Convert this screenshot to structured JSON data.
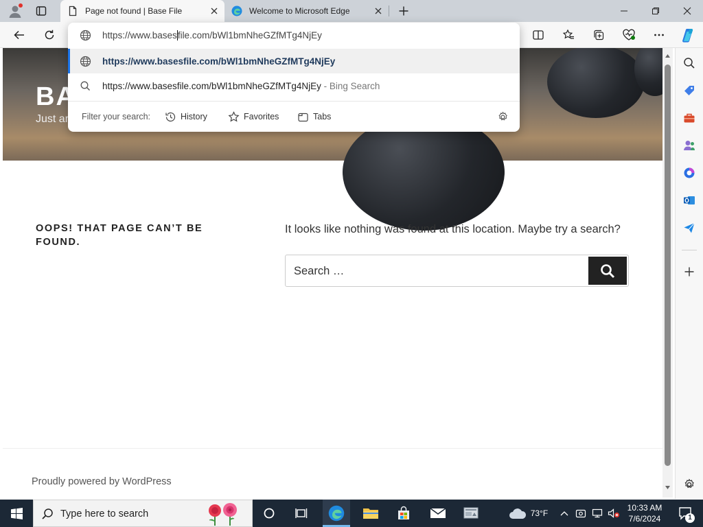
{
  "browser": {
    "tabs": [
      {
        "title": "Page not found | Base File",
        "active": true
      },
      {
        "title": "Welcome to Microsoft Edge",
        "active": false
      }
    ],
    "address": {
      "typed_url": "https://www.basesfile.com/bWl1bmNheGZfMTg4NjEy",
      "typed_prefix": "https://www.bases",
      "typed_suffix": "file.com/bWl1bmNheGZfMTg4NjEy"
    },
    "suggestions": [
      {
        "text": "https://www.basesfile.com/bWl1bmNheGZfMTg4NjEy",
        "type": "url",
        "selected": true
      },
      {
        "text": "https://www.basesfile.com/bWl1bmNheGZfMTg4NjEy",
        "suffix": "- Bing Search",
        "type": "search",
        "selected": false
      }
    ],
    "filter": {
      "label": "Filter your search:",
      "chips": [
        "History",
        "Favorites",
        "Tabs"
      ]
    }
  },
  "page": {
    "hero_title": "BA",
    "hero_subtitle": "Just ar",
    "error_title": "OOPS! THAT PAGE CAN’T BE FOUND.",
    "error_message": "It looks like nothing was found at this location. Maybe try a search?",
    "search_placeholder": "Search …",
    "footer": "Proudly powered by WordPress"
  },
  "taskbar": {
    "search_placeholder": "Type here to search",
    "weather": "73°F",
    "time": "10:33 AM",
    "date": "7/6/2024",
    "notification_count": "1"
  },
  "colors": {
    "accent": "#1a73e8",
    "taskbar": "#1c2836",
    "search_button": "#222222"
  },
  "icons": [
    "profile-icon",
    "tab-actions-icon",
    "page-icon",
    "edge-icon",
    "close-icon",
    "new-tab-icon",
    "back-icon",
    "refresh-icon",
    "split-screen-icon",
    "favorites-icon",
    "collections-icon",
    "browser-essentials-icon",
    "more-icon",
    "copilot-icon",
    "search-icon",
    "tag-icon",
    "toolbox-icon",
    "people-icon",
    "office-icon",
    "outlook-icon",
    "send-icon",
    "plus-icon",
    "settings-icon",
    "windows-start-icon",
    "task-view-icon",
    "file-explorer-icon",
    "store-icon",
    "mail-icon",
    "weather-icon"
  ]
}
